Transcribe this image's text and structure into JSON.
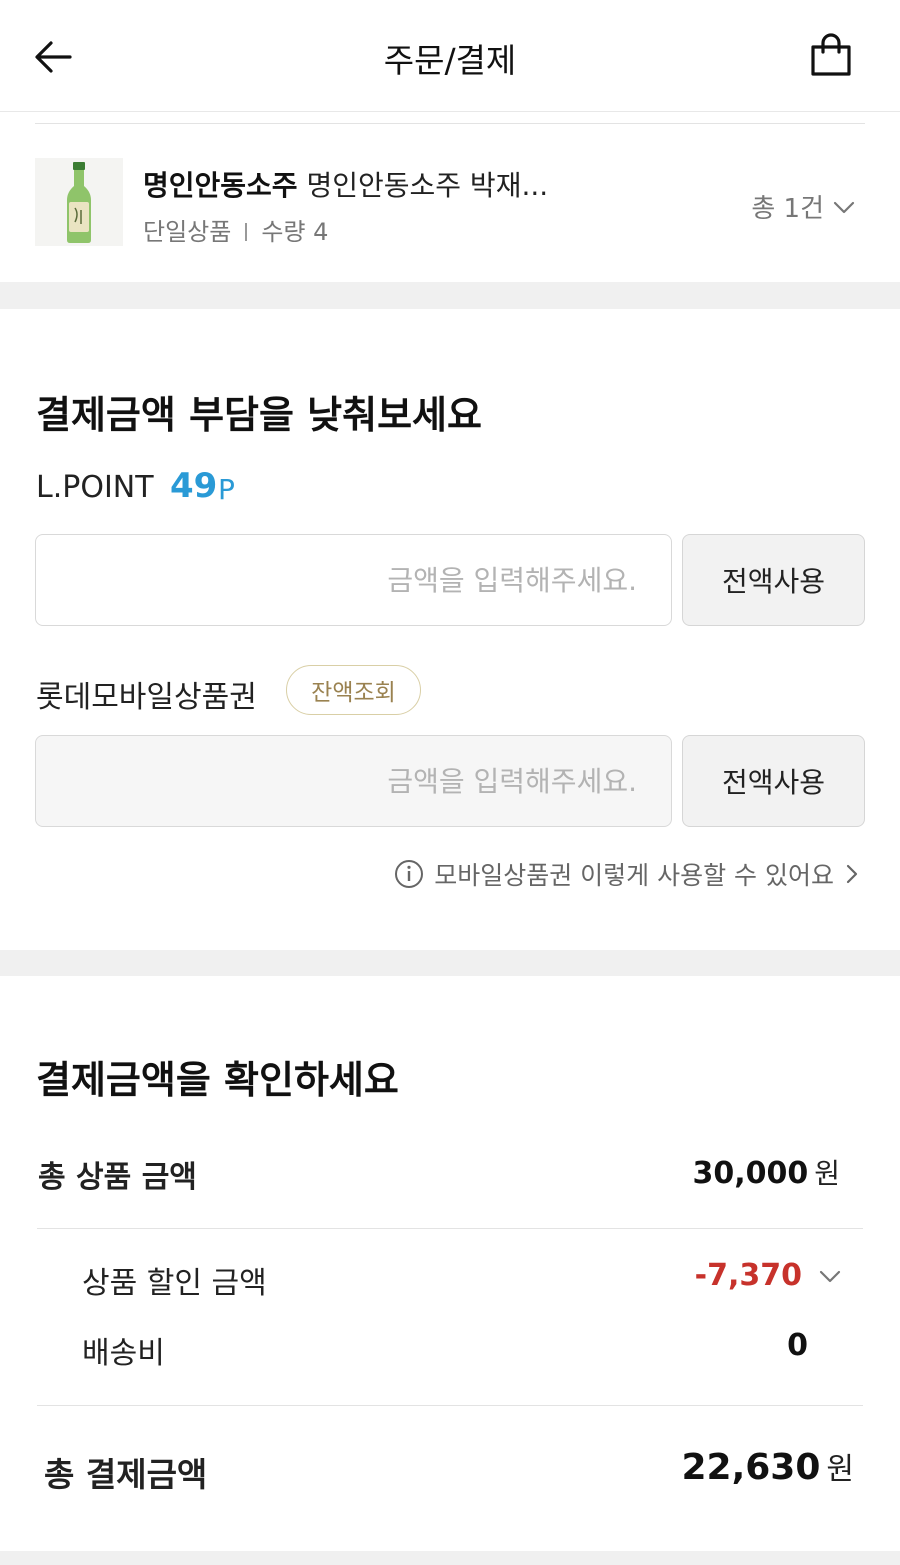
{
  "header": {
    "title": "주문/결제",
    "back_icon": "arrow-left-icon",
    "cart_icon": "shopping-bag-icon"
  },
  "product": {
    "brand": "명인안동소주",
    "name": "명인안동소주 박재...",
    "type": "단일상품",
    "quantity": "수량 4",
    "total_count": "총 1건"
  },
  "discount_section": {
    "title": "결제금액 부담을 낮춰보세요",
    "lpoint": {
      "label": "L.POINT",
      "value": "49",
      "unit": "P",
      "placeholder": "금액을 입력해주세요.",
      "use_all": "전액사용"
    },
    "giftcard": {
      "label": "롯데모바일상품권",
      "balance_button": "잔액조회",
      "placeholder": "금액을 입력해주세요.",
      "use_all": "전액사용"
    },
    "help_link": "모바일상품권 이렇게 사용할 수 있어요"
  },
  "summary": {
    "title": "결제금액을 확인하세요",
    "total_product_label": "총 상품 금액",
    "total_product_value": "30,000",
    "discount_label": "상품 할인 금액",
    "discount_value": "-7,370",
    "shipping_label": "배송비",
    "shipping_value": "0",
    "grand_total_label": "총 결제금액",
    "grand_total_value": "22,630",
    "currency": "원"
  },
  "colors": {
    "accent_blue": "#2a9ad6",
    "discount_red": "#c7322b",
    "gold": "#9a8250",
    "divider": "#f0f0f0"
  }
}
